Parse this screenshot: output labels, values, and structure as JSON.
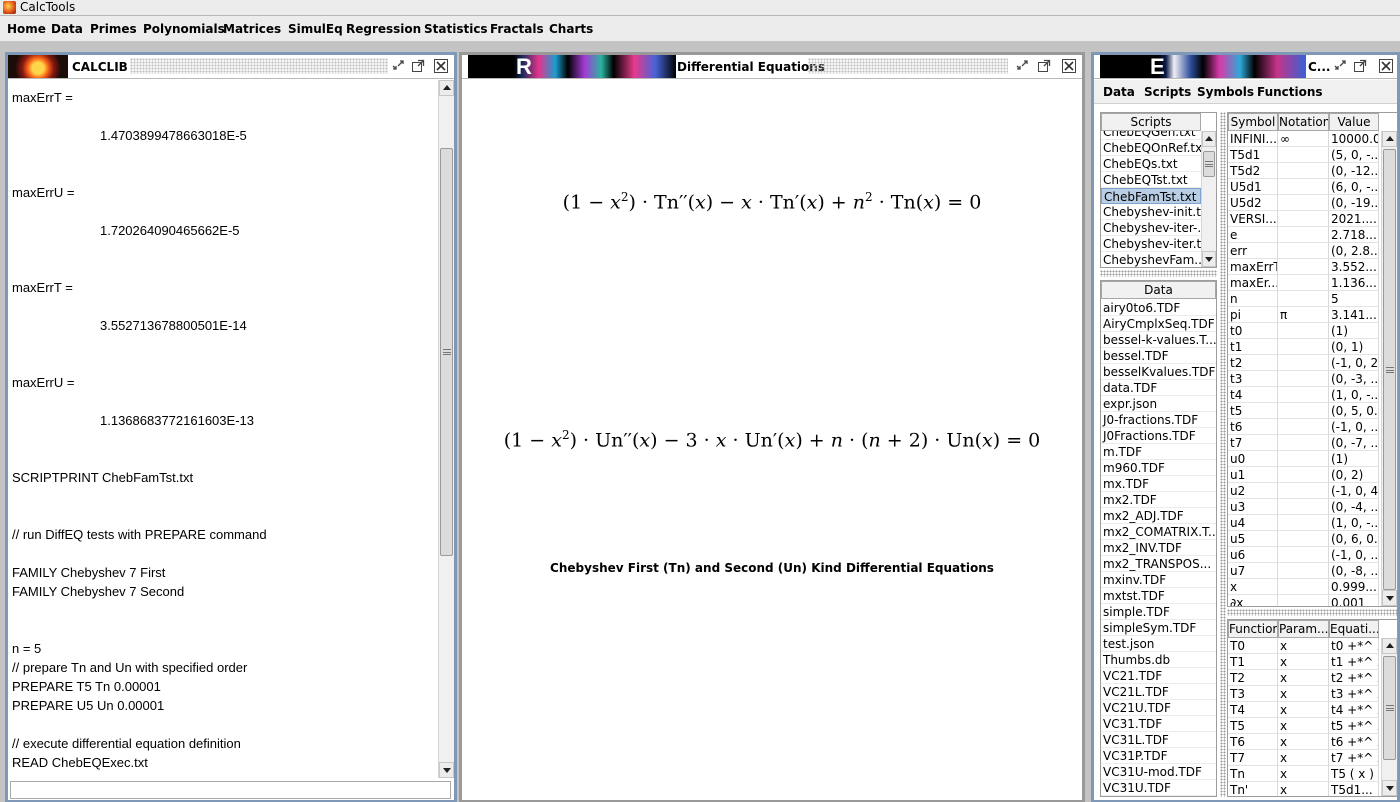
{
  "app": {
    "title": "CalcTools"
  },
  "menu": [
    "Home",
    "Data",
    "Primes",
    "Polynomials",
    "Matrices",
    "SimulEq",
    "Regression",
    "Statistics",
    "Fractals",
    "Charts"
  ],
  "calclib": {
    "title": "CALCLIB",
    "lines": [
      "maxErrT =",
      "1.4703899478663018E-5",
      "maxErrU =",
      "1.720264090465662E-5",
      "maxErrT =",
      "3.552713678800501E-14",
      "maxErrU =",
      "1.1368683772161603E-13",
      "SCRIPTPRINT ChebFamTst.txt",
      "// run DiffEQ tests with PREPARE command",
      "FAMILY Chebyshev 7 First",
      "FAMILY Chebyshev 7 Second",
      "n = 5",
      "// prepare Tn and Un with specified order",
      "PREPARE T5 Tn 0.00001",
      "PREPARE U5 Un 0.00001",
      "// execute differential equation definition",
      "READ ChebEQExec.txt"
    ],
    "input_value": ""
  },
  "diffeq": {
    "title": "Differential Equations",
    "thumb_letter": "R",
    "caption": "Chebyshev First (Tn) and Second (Un) Kind Differential Equations",
    "eq1": {
      "p1": "(1 − ",
      "p2": ")",
      "p3": " · Tn′′(",
      "p4": ") − ",
      "p5": " · Tn′(",
      "p6": ") + ",
      "p7": " · Tn(",
      "p8": ") = 0",
      "x": "x",
      "n": "n",
      "sq": "2"
    },
    "eq2": {
      "p1": "(1 − ",
      "p2": ")",
      "p3": " · Un′′(",
      "p4": ") − 3 · ",
      "p5": " · Un′(",
      "p6": ") + ",
      "p7": " · (",
      "p8": " + 2) · Un(",
      "p9": ") = 0",
      "x": "x",
      "n": "n",
      "sq": "2"
    }
  },
  "explorer": {
    "thumb_letter": "E",
    "title": "C...",
    "menu": [
      "Data",
      "Scripts",
      "Symbols",
      "Functions"
    ],
    "scripts_header": "Scripts",
    "scripts": [
      "ChebEQGen.txt",
      "ChebEQOnRef.txt",
      "ChebEQs.txt",
      "ChebEQTst.txt",
      "ChebFamTst.txt",
      "Chebyshev-init.txt",
      "Chebyshev-iter-...",
      "Chebyshev-iter.txt",
      "ChebyshevFam..."
    ],
    "scripts_selected": "ChebFamTst.txt",
    "data_header": "Data",
    "data_files": [
      "airy0to6.TDF",
      "AiryCmplxSeq.TDF",
      "bessel-k-values.T...",
      "bessel.TDF",
      "besselKvalues.TDF",
      "data.TDF",
      "expr.json",
      "J0-fractions.TDF",
      "J0Fractions.TDF",
      "m.TDF",
      "m960.TDF",
      "mx.TDF",
      "mx2.TDF",
      "mx2_ADJ.TDF",
      "mx2_COMATRIX.T...",
      "mx2_INV.TDF",
      "mx2_TRANSPOS...",
      "mxinv.TDF",
      "mxtst.TDF",
      "simple.TDF",
      "simpleSym.TDF",
      "test.json",
      "Thumbs.db",
      "VC21.TDF",
      "VC21L.TDF",
      "VC21U.TDF",
      "VC31.TDF",
      "VC31L.TDF",
      "VC31P.TDF",
      "VC31U-mod.TDF",
      "VC31U.TDF"
    ],
    "symbols_headers": [
      "Symbol",
      "Notation",
      "Value"
    ],
    "symbols": [
      [
        "INFINI...",
        "∞",
        "10000.0"
      ],
      [
        "T5d1",
        "",
        "(5, 0, -..."
      ],
      [
        "T5d2",
        "",
        "(0, -12..."
      ],
      [
        "U5d1",
        "",
        "(6, 0, -..."
      ],
      [
        "U5d2",
        "",
        "(0, -19..."
      ],
      [
        "VERSI...",
        "",
        "2021...."
      ],
      [
        "e",
        "",
        "2.718..."
      ],
      [
        "err",
        "",
        "(0, 2.8..."
      ],
      [
        "maxErrT",
        "",
        "3.552..."
      ],
      [
        "maxEr...",
        "",
        "1.136..."
      ],
      [
        "n",
        "",
        "5"
      ],
      [
        "pi",
        "π",
        "3.141..."
      ],
      [
        "t0",
        "",
        "(1)"
      ],
      [
        "t1",
        "",
        "(0, 1)"
      ],
      [
        "t2",
        "",
        "(-1, 0, 2)"
      ],
      [
        "t3",
        "",
        "(0, -3, ..."
      ],
      [
        "t4",
        "",
        "(1, 0, -..."
      ],
      [
        "t5",
        "",
        "(0, 5, 0..."
      ],
      [
        "t6",
        "",
        "(-1, 0, ..."
      ],
      [
        "t7",
        "",
        "(0, -7, ..."
      ],
      [
        "u0",
        "",
        "(1)"
      ],
      [
        "u1",
        "",
        "(0, 2)"
      ],
      [
        "u2",
        "",
        "(-1, 0, 4)"
      ],
      [
        "u3",
        "",
        "(0, -4, ..."
      ],
      [
        "u4",
        "",
        "(1, 0, -..."
      ],
      [
        "u5",
        "",
        "(0, 6, 0..."
      ],
      [
        "u6",
        "",
        "(-1, 0, ..."
      ],
      [
        "u7",
        "",
        "(0, -8, ..."
      ],
      [
        "x",
        "",
        "0.999..."
      ],
      [
        "∂x",
        "",
        "0.001"
      ]
    ],
    "functions_headers": [
      "Function",
      "Param...",
      "Equati..."
    ],
    "functions": [
      [
        "T0",
        "x",
        "t0 +*^ x"
      ],
      [
        "T1",
        "x",
        "t1 +*^ x"
      ],
      [
        "T2",
        "x",
        "t2 +*^ x"
      ],
      [
        "T3",
        "x",
        "t3 +*^ x"
      ],
      [
        "T4",
        "x",
        "t4 +*^ x"
      ],
      [
        "T5",
        "x",
        "t5 +*^ x"
      ],
      [
        "T6",
        "x",
        "t6 +*^ x"
      ],
      [
        "T7",
        "x",
        "t7 +*^ x"
      ],
      [
        "Tn",
        "x",
        "T5 ( x )"
      ],
      [
        "Tn'",
        "x",
        "T5d1..."
      ]
    ]
  },
  "colors": {
    "active_border": "#7f98b7",
    "inactive_border": "#999999",
    "selection": "#b9cde5"
  }
}
